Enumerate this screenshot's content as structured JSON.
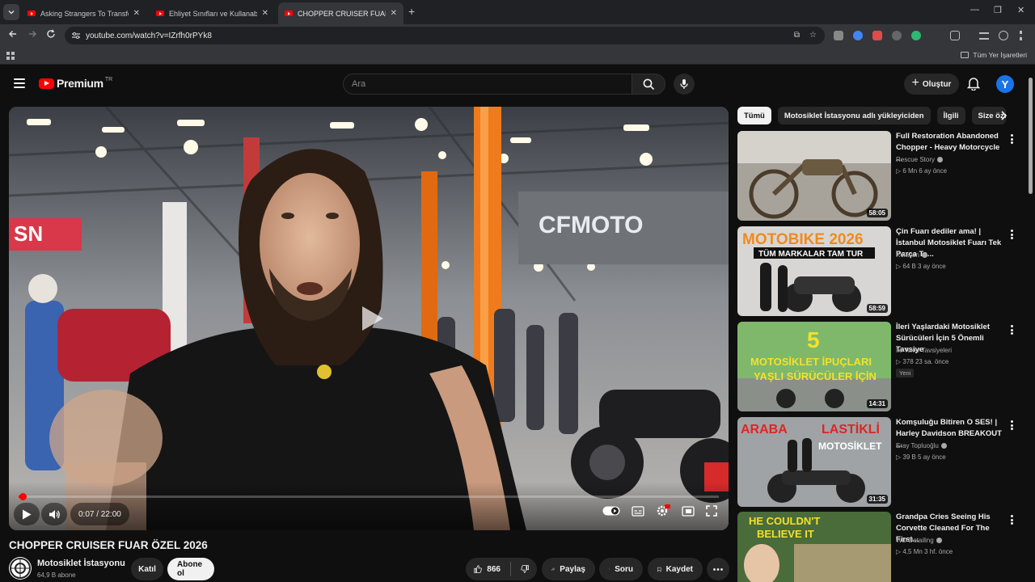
{
  "browser": {
    "tabs": [
      {
        "label": "Asking Strangers To Transform"
      },
      {
        "label": "Ehliyet Sınıfları ve Kullanabil"
      },
      {
        "label": "CHOPPER CRUISER FUAR ÖZEL"
      }
    ],
    "url": "youtube.com/watch?v=IZrfh0rPYk8",
    "bookmarks_all": "Tüm Yer İşaretleri"
  },
  "header": {
    "logo_text": "Premium",
    "logo_country": "TR",
    "search_placeholder": "Ara",
    "create_label": "Oluştur",
    "avatar_letter": "Y"
  },
  "player": {
    "time": "0:07 / 22:00",
    "progress_fraction": 0.0053,
    "overlay_text": "CFMOTO"
  },
  "video": {
    "title": "CHOPPER CRUISER FUAR ÖZEL 2026",
    "channel": "Motosiklet İstasyonu",
    "subscribers": "64,9 B abone",
    "join_label": "Katıl",
    "subscribe_label": "Abone ol",
    "likes": "866",
    "share_label": "Paylaş",
    "ask_label": "Soru",
    "save_label": "Kaydet"
  },
  "chips": [
    "Tümü",
    "Motosiklet İstasyonu adlı yükleyiciden",
    "İlgili",
    "Size özel"
  ],
  "recommendations": [
    {
      "title": "Full Restoration Abandoned Chopper - Heavy Motorcycle ...",
      "channel": "Rescue Story",
      "meta": "▷ 6 Mn   6 ay önce",
      "duration": "58:05",
      "badge": ""
    },
    {
      "title": "Çin Fuarı dediler ama! | İstanbul Motosiklet Fuarı Tek Parça Ta...",
      "channel": "Kolaçan",
      "meta": "▷ 64 B   3 ay önce",
      "duration": "58:59",
      "badge": "",
      "thumb_text": [
        "MOTOBIKE 2026",
        "TÜM MARKALAR TAM TUR"
      ]
    },
    {
      "title": "İleri Yaşlardaki Motosiklet Sürücüleri İçin 5 Önemli Tavsiye",
      "channel": "İki Teker Tavsiyeleri",
      "meta": "▷ 378   23 sa. önce",
      "duration": "14:31",
      "badge": "Yeni",
      "thumb_text": [
        "5",
        "MOTOSİKLET İPUÇLARI",
        "YAŞLI SÜRÜCÜLER İÇİN"
      ]
    },
    {
      "title": "Komşuluğu Bitiren O SES! | Harley Davidson BREAKOUT ...",
      "channel": "Eray Topluoğlu",
      "meta": "▷ 39 B   5 ay önce",
      "duration": "31:35",
      "badge": "",
      "thumb_text": [
        "ARABA",
        "LASTİKLİ",
        "MOTOSİKLET"
      ]
    },
    {
      "title": "Grandpa Cries Seeing His Corvette Cleaned For The First...",
      "channel": "WD Detailing",
      "meta": "▷ 4,5 Mn   3 hf. önce",
      "duration": "",
      "badge": "",
      "thumb_text": [
        "HE COULDN'T",
        "BELIEVE IT"
      ]
    }
  ]
}
